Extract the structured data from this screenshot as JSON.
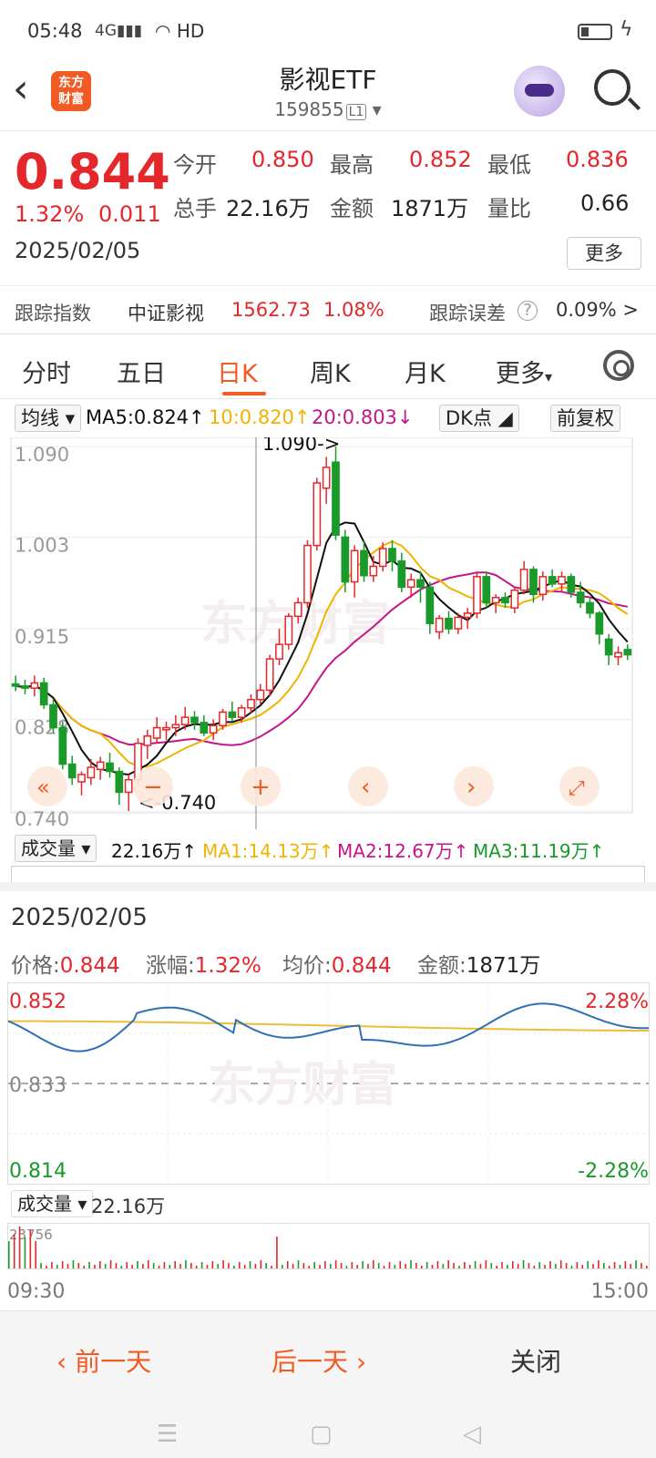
{
  "status_bar": {
    "time": "05:48",
    "network": "4G",
    "hd": "HD"
  },
  "header": {
    "back_icon": "chevron-left-icon",
    "logo_text": "东方\n财富",
    "title": "影视ETF",
    "code": "159855",
    "level": "L1"
  },
  "quote": {
    "price": "0.844",
    "change_pct": "1.32%",
    "change_abs": "0.011",
    "date": "2025/02/05",
    "open_label": "今开",
    "open": "0.850",
    "high_label": "最高",
    "high": "0.852",
    "low_label": "最低",
    "low": "0.836",
    "volume_label": "总手",
    "volume": "22.16万",
    "amount_label": "金额",
    "amount": "1871万",
    "ratio_label": "量比",
    "ratio": "0.66",
    "more_label": "更多",
    "track_label": "跟踪指数",
    "index_name": "中证影视",
    "index_value": "1562.73",
    "index_pct": "1.08%",
    "track_err_label": "跟踪误差",
    "track_err": "0.09% >"
  },
  "tabs": [
    "分时",
    "五日",
    "日K",
    "周K",
    "月K",
    "更多"
  ],
  "active_tab": 2,
  "ma_bar": {
    "type_label": "均线",
    "ma5": "MA5:0.824",
    "ma10": "10:0.820",
    "ma20": "20:0.803",
    "dk_label": "DK点",
    "adjust_label": "前复权"
  },
  "kline": {
    "y_labels": [
      "1.090",
      "1.003",
      "0.915",
      "0.828",
      "0.740"
    ],
    "max_label": "1.090->",
    "min_label": "<-0.740",
    "colors": {
      "up": "#e5262b",
      "down": "#1a9a2b",
      "ma5": "#111111",
      "ma10": "#f0b400",
      "ma20": "#c4168a"
    }
  },
  "chart_data": {
    "type": "candlestick",
    "ylim": [
      0.74,
      1.09
    ],
    "ohlc": [
      [
        0.862,
        0.87,
        0.855,
        0.86
      ],
      [
        0.86,
        0.866,
        0.852,
        0.858
      ],
      [
        0.858,
        0.87,
        0.85,
        0.863
      ],
      [
        0.863,
        0.868,
        0.838,
        0.842
      ],
      [
        0.842,
        0.848,
        0.815,
        0.82
      ],
      [
        0.82,
        0.826,
        0.78,
        0.785
      ],
      [
        0.785,
        0.793,
        0.765,
        0.772
      ],
      [
        0.768,
        0.778,
        0.755,
        0.775
      ],
      [
        0.772,
        0.79,
        0.765,
        0.782
      ],
      [
        0.78,
        0.792,
        0.77,
        0.787
      ],
      [
        0.786,
        0.796,
        0.772,
        0.778
      ],
      [
        0.778,
        0.782,
        0.746,
        0.758
      ],
      [
        0.758,
        0.775,
        0.74,
        0.77
      ],
      [
        0.77,
        0.81,
        0.765,
        0.805
      ],
      [
        0.803,
        0.818,
        0.79,
        0.812
      ],
      [
        0.81,
        0.83,
        0.805,
        0.82
      ],
      [
        0.818,
        0.826,
        0.808,
        0.82
      ],
      [
        0.82,
        0.832,
        0.812,
        0.823
      ],
      [
        0.823,
        0.84,
        0.818,
        0.83
      ],
      [
        0.83,
        0.836,
        0.818,
        0.825
      ],
      [
        0.825,
        0.832,
        0.812,
        0.815
      ],
      [
        0.815,
        0.828,
        0.808,
        0.822
      ],
      [
        0.822,
        0.838,
        0.818,
        0.835
      ],
      [
        0.835,
        0.845,
        0.826,
        0.83
      ],
      [
        0.83,
        0.842,
        0.825,
        0.839
      ],
      [
        0.839,
        0.852,
        0.834,
        0.847
      ],
      [
        0.847,
        0.862,
        0.842,
        0.856
      ],
      [
        0.856,
        0.89,
        0.85,
        0.886
      ],
      [
        0.886,
        0.915,
        0.88,
        0.9
      ],
      [
        0.9,
        0.93,
        0.895,
        0.927
      ],
      [
        0.927,
        0.945,
        0.92,
        0.94
      ],
      [
        0.94,
        1.0,
        0.935,
        0.995
      ],
      [
        0.995,
        1.06,
        0.99,
        1.055
      ],
      [
        1.05,
        1.08,
        1.035,
        1.07
      ],
      [
        1.075,
        1.09,
        1.0,
        1.005
      ],
      [
        1.003,
        1.01,
        0.95,
        0.96
      ],
      [
        0.96,
        0.995,
        0.945,
        0.99
      ],
      [
        0.99,
        1.0,
        0.96,
        0.966
      ],
      [
        0.966,
        0.985,
        0.96,
        0.975
      ],
      [
        0.975,
        0.998,
        0.97,
        0.992
      ],
      [
        0.992,
        1.0,
        0.97,
        0.98
      ],
      [
        0.98,
        0.988,
        0.95,
        0.955
      ],
      [
        0.955,
        0.968,
        0.945,
        0.962
      ],
      [
        0.962,
        0.97,
        0.94,
        0.955
      ],
      [
        0.955,
        0.96,
        0.91,
        0.92
      ],
      [
        0.912,
        0.928,
        0.905,
        0.925
      ],
      [
        0.925,
        0.932,
        0.91,
        0.915
      ],
      [
        0.915,
        0.93,
        0.91,
        0.926
      ],
      [
        0.926,
        0.935,
        0.915,
        0.93
      ],
      [
        0.93,
        0.97,
        0.925,
        0.965
      ],
      [
        0.965,
        0.97,
        0.935,
        0.94
      ],
      [
        0.94,
        0.948,
        0.93,
        0.945
      ],
      [
        0.945,
        0.95,
        0.935,
        0.94
      ],
      [
        0.935,
        0.955,
        0.93,
        0.952
      ],
      [
        0.952,
        0.98,
        0.948,
        0.972
      ],
      [
        0.972,
        0.975,
        0.94,
        0.948
      ],
      [
        0.948,
        0.97,
        0.942,
        0.965
      ],
      [
        0.965,
        0.972,
        0.955,
        0.958
      ],
      [
        0.958,
        0.97,
        0.95,
        0.965
      ],
      [
        0.965,
        0.968,
        0.945,
        0.95
      ],
      [
        0.95,
        0.96,
        0.935,
        0.94
      ],
      [
        0.94,
        0.945,
        0.925,
        0.93
      ],
      [
        0.93,
        0.932,
        0.9,
        0.91
      ],
      [
        0.905,
        0.91,
        0.88,
        0.89
      ],
      [
        0.888,
        0.898,
        0.88,
        0.892
      ],
      [
        0.895,
        0.9,
        0.885,
        0.89
      ]
    ]
  },
  "vol_bar": {
    "type_label": "成交量",
    "vol": "22.16万",
    "ma1": "MA1:14.13万",
    "ma2": "MA2:12.67万",
    "ma3": "MA3:11.19万"
  },
  "intraday": {
    "date": "2025/02/05",
    "price_label": "价格:",
    "price": "0.844",
    "pct_label": "涨幅:",
    "pct": "1.32%",
    "avg_label": "均价:",
    "avg": "0.844",
    "amount_label": "金额:",
    "amount": "1871万",
    "top_price": "0.852",
    "mid_price": "0.833",
    "bottom_price": "0.814",
    "top_pct": "2.28%",
    "bottom_pct": "-2.28%",
    "vol_type": "成交量",
    "vol_total": "22.16万",
    "vol_max": "23756",
    "time_start": "09:30",
    "time_end": "15:00"
  },
  "bottom_nav": {
    "prev": "前一天",
    "next": "后一天",
    "close": "关闭"
  },
  "watermark": "东方财富"
}
